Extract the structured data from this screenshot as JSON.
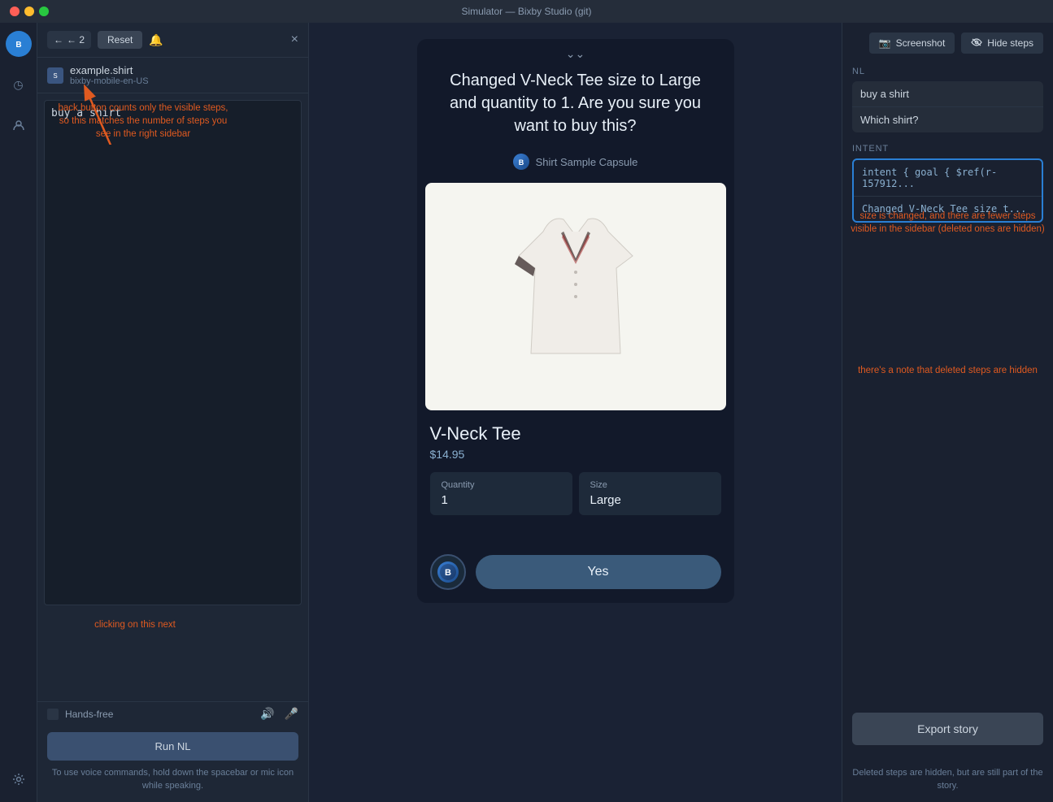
{
  "titleBar": {
    "title": "Simulator — Bixby Studio (git)"
  },
  "iconSidebar": {
    "bixbyIcon": "B",
    "historyIcon": "◷",
    "userIcon": "👤",
    "gearIcon": "⚙"
  },
  "leftPanel": {
    "backLabel": "← 2",
    "resetLabel": "Reset",
    "notifIcon": "🔔",
    "closeIcon": "×",
    "capsuleName": "example.shirt",
    "capsuleId": "bixby-mobile-en-US",
    "nlInputValue": "buy a shirt",
    "handsFreeLabel": "Hands-free",
    "runNlLabel": "Run NL",
    "voiceHint": "To use voice commands, hold down the spacebar or\nmic icon while speaking."
  },
  "annotations": {
    "backButtonNote": "back button counts only the\nvisible steps, so this matches\nthe number of steps you see\nin the right sidebar",
    "clickingNote": "clicking on this next",
    "sizeChangedNote": "size is changed, and there are\nfewer steps visible in the sidebar\n(deleted ones are hidden)",
    "deletedNoteTop": "there's a note that deleted\nsteps are hidden",
    "deletedNoteBottom": "Deleted steps are hidden, but are\nstill part of the story."
  },
  "centerPanel": {
    "chevron": "⌄⌄",
    "message": "Changed V-Neck Tee size to Large and quantity to 1. Are you sure you want to buy this?",
    "brandName": "Shirt Sample Capsule",
    "productName": "V-Neck Tee",
    "productPrice": "$14.95",
    "quantity": {
      "label": "Quantity",
      "value": "1"
    },
    "size": {
      "label": "Size",
      "value": "Large"
    },
    "yesLabel": "Yes"
  },
  "rightPanel": {
    "screenshotLabel": "Screenshot",
    "hideStepsLabel": "Hide steps",
    "nlSectionLabel": "NL",
    "intentSectionLabel": "INTENT",
    "nlItems": [
      "buy a shirt",
      "Which shirt?"
    ],
    "intentItems": [
      "intent { goal { $ref(r-157912...",
      "Changed V-Neck Tee size t..."
    ],
    "exportStoryLabel": "Export story",
    "deletedNote": "Deleted steps are hidden, but are\nstill part of the story."
  }
}
